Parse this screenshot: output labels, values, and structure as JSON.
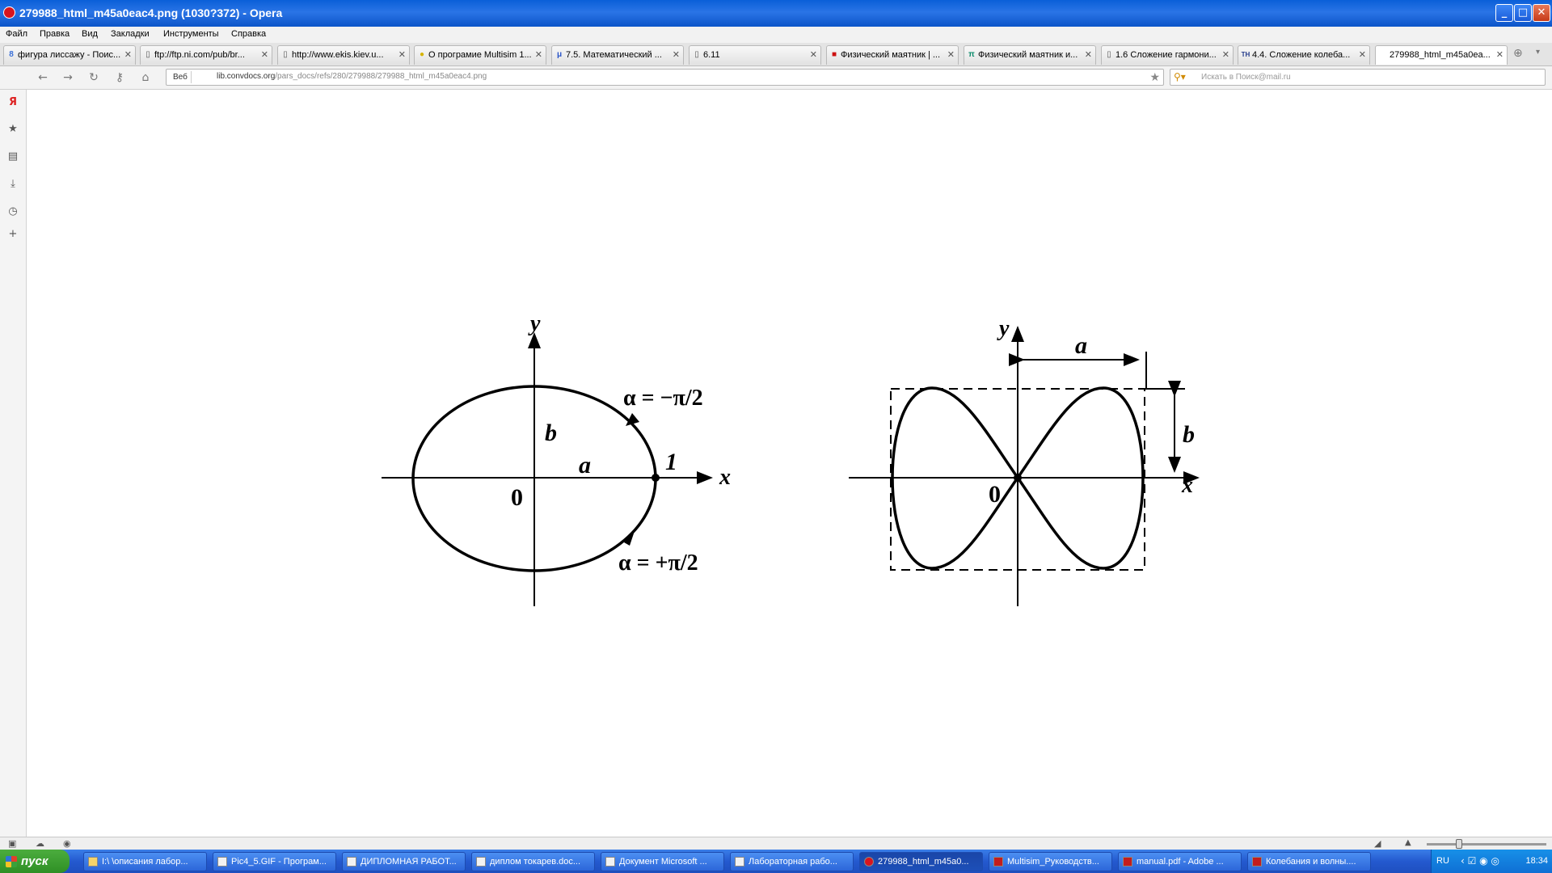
{
  "window": {
    "title": "279988_html_m45a0eac4.png (1030?372) - Opera"
  },
  "menu": [
    "Файл",
    "Правка",
    "Вид",
    "Закладки",
    "Инструменты",
    "Справка"
  ],
  "tabs": [
    {
      "label": "фигура лиссажу - Поис...",
      "active": false
    },
    {
      "label": "ftp://ftp.ni.com/pub/br...",
      "active": false
    },
    {
      "label": "http://www.ekis.kiev.u...",
      "active": false
    },
    {
      "label": "О програмие Multisim 1...",
      "active": false
    },
    {
      "label": "7.5. Математический ...",
      "active": false
    },
    {
      "label": "6.11",
      "active": false
    },
    {
      "label": "Физический маятник | ...",
      "active": false
    },
    {
      "label": "Физический маятник и...",
      "active": false
    },
    {
      "label": "1.6 Сложение гармони...",
      "active": false
    },
    {
      "label": "4.4. Сложение колеба...",
      "active": false
    },
    {
      "label": "279988_html_m45a0ea...",
      "active": true
    }
  ],
  "address": {
    "badge": "Веб",
    "url_host": "lib.convdocs.org",
    "url_path": "/pars_docs/refs/280/279988/279988_html_m45a0eac4.png",
    "search_placeholder": "Искать в Поиск@mail.ru"
  },
  "figure": {
    "left": {
      "y_label": "y",
      "x_label": "x",
      "origin": "0",
      "b": "b",
      "a": "a",
      "point": "1",
      "alpha_top": "α = −π/2",
      "alpha_bottom": "α = +π/2"
    },
    "right": {
      "y_label": "y",
      "x_label": "x",
      "origin": "0",
      "a": "a",
      "b": "b"
    }
  },
  "taskbar": {
    "start": "пуск",
    "tasks": [
      {
        "label": "I:\\ \\описания лабор...",
        "active": false
      },
      {
        "label": "Pic4_5.GIF - Програм...",
        "active": false
      },
      {
        "label": "ДИПЛОМНАЯ РАБОТ...",
        "active": false
      },
      {
        "label": "диплом токарев.doc...",
        "active": false
      },
      {
        "label": "Документ Microsoft ...",
        "active": false
      },
      {
        "label": "Лабораторная рабо...",
        "active": false
      },
      {
        "label": "279988_html_m45a0...",
        "active": true
      },
      {
        "label": "Multisim_Руководств...",
        "active": false
      },
      {
        "label": "manual.pdf - Adobe ...",
        "active": false
      },
      {
        "label": "Колебания и волны....",
        "active": false
      }
    ],
    "lang": "RU",
    "clock": "18:34"
  }
}
